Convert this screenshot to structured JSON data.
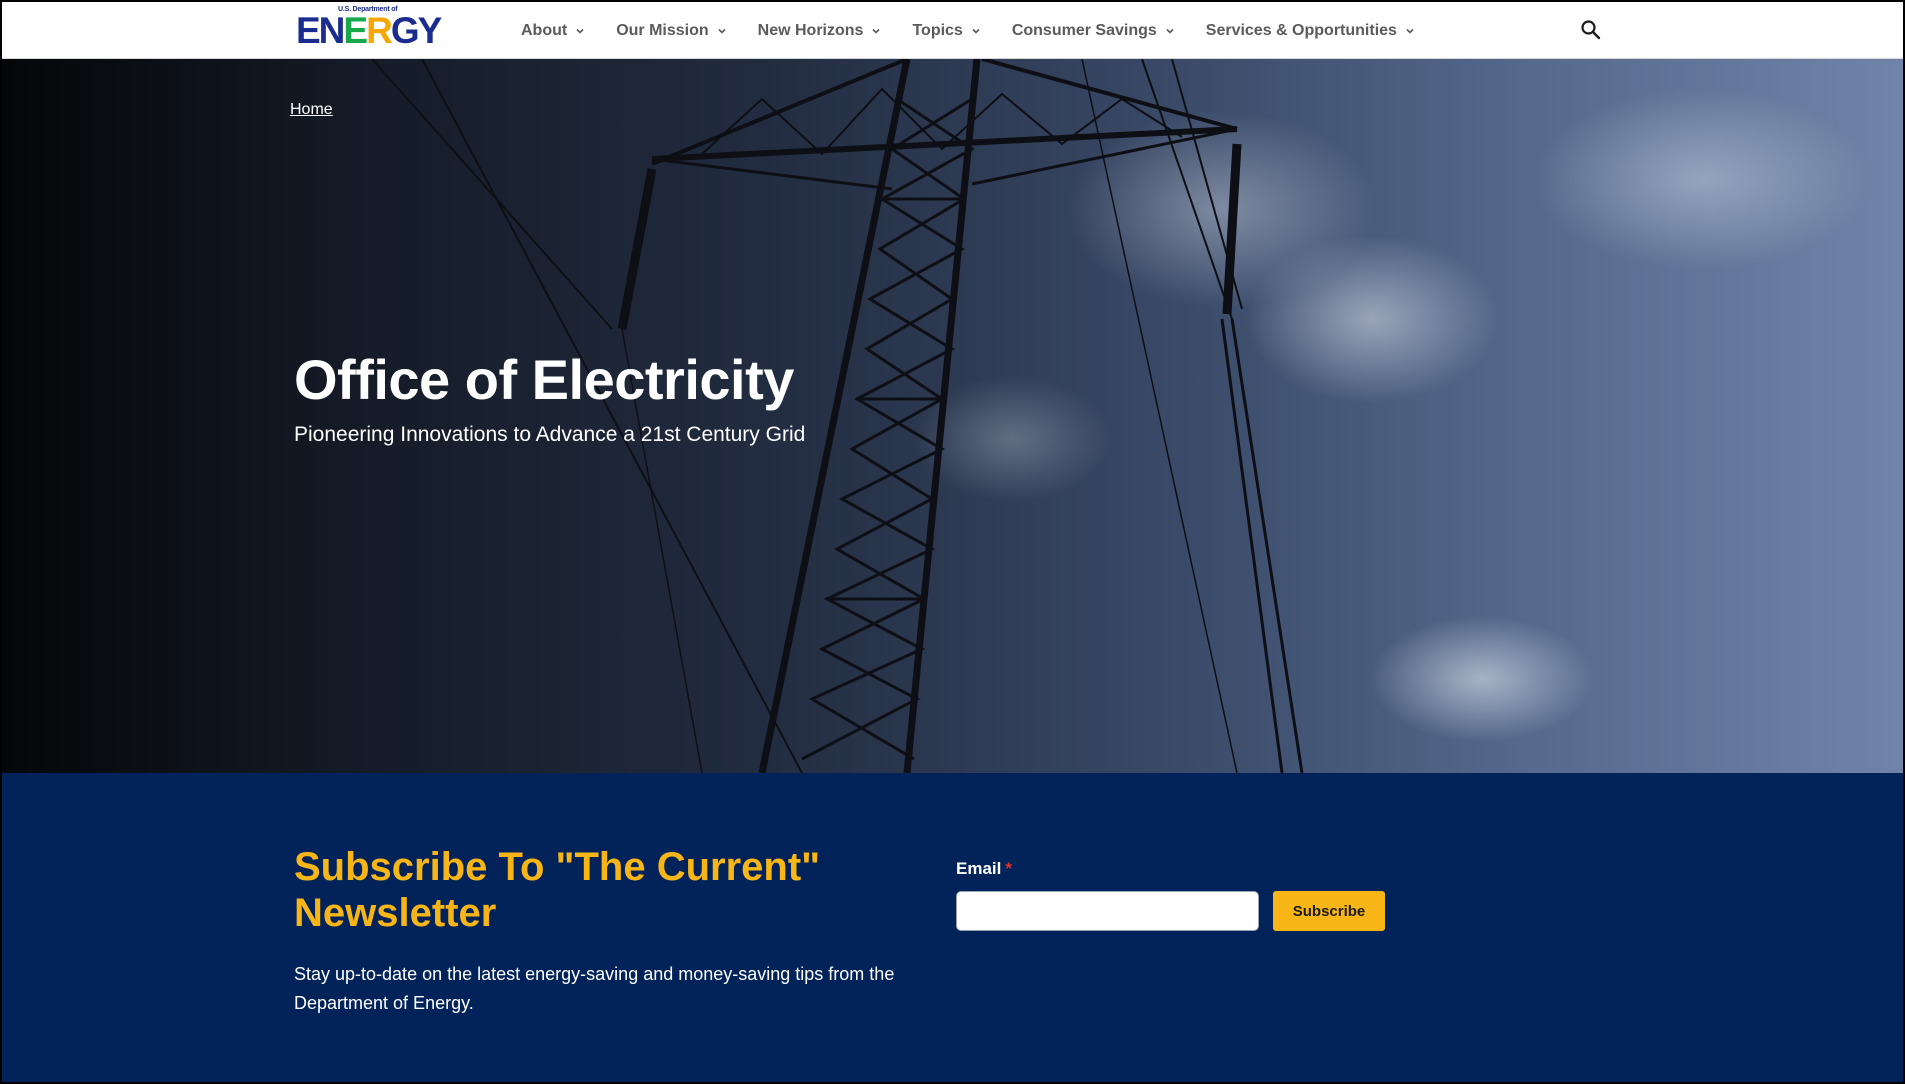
{
  "header": {
    "logo": {
      "top_text": "U.S. Department of",
      "word": "ENERGY",
      "alt": "U.S. Department of Energy"
    },
    "nav": [
      {
        "label": "About",
        "icon": "chevron-down-icon"
      },
      {
        "label": "Our Mission",
        "icon": "chevron-down-icon"
      },
      {
        "label": "New Horizons",
        "icon": "chevron-down-icon"
      },
      {
        "label": "Topics",
        "icon": "chevron-down-icon"
      },
      {
        "label": "Consumer Savings",
        "icon": "chevron-down-icon"
      },
      {
        "label": "Services & Opportunities",
        "icon": "chevron-down-icon"
      }
    ],
    "search_icon": "search-icon"
  },
  "hero": {
    "breadcrumb": "Home",
    "title": "Office of Electricity",
    "subtitle": "Pioneering Innovations to Advance a 21st Century Grid"
  },
  "newsletter": {
    "title": "Subscribe To \"The Current\" Newsletter",
    "description": "Stay up-to-date on the latest energy-saving and money-saving tips from the Department of Energy.",
    "email_label": "Email",
    "required_mark": "*",
    "email_value": "",
    "subscribe_label": "Subscribe"
  },
  "colors": {
    "nav_text": "#5b5b5b",
    "brand_navy": "#012359",
    "accent_gold": "#f8b616",
    "logo_blue": "#1b2c8f",
    "logo_green": "#17a84b",
    "required_red": "#e2302b"
  }
}
